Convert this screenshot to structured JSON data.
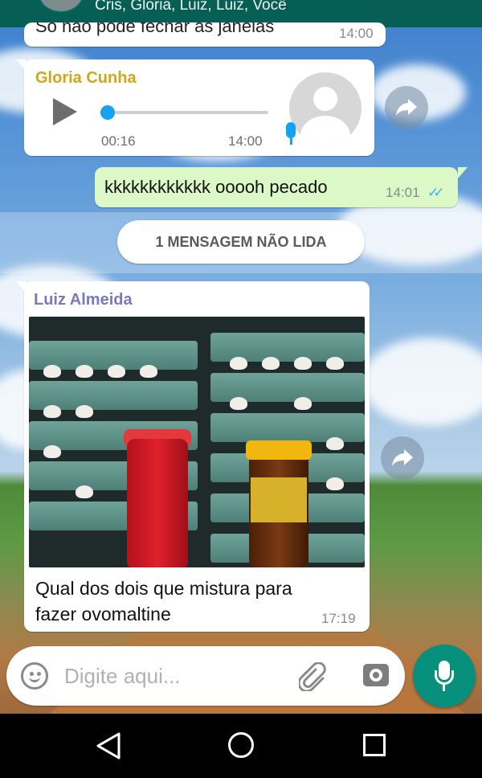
{
  "header": {
    "participants": "Cris, Gloria, Luiz, Luiz, Você"
  },
  "messages": {
    "previous": {
      "text": "Só não pode fechar as janelas",
      "time": "14:00"
    },
    "audio": {
      "sender": "Gloria Cunha",
      "sender_color": "#d4a515",
      "duration": "00:16",
      "time": "14:00",
      "progress": 0.0
    },
    "outgoing": {
      "text": "kkkkkkkkkkkk ooooh pecado",
      "time": "14:01",
      "status": "read"
    },
    "unread_banner": "1 MENSAGEM NÃO LIDA",
    "image": {
      "sender": "Luiz Almeida",
      "sender_color": "#7b79b8",
      "caption": "Qual dos dois que mistura para fazer ovomaltine",
      "time": "17:19"
    }
  },
  "input": {
    "placeholder": "Digite aqui..."
  },
  "icons": {
    "emoji": "emoji-icon",
    "attach": "paperclip-icon",
    "camera": "camera-icon",
    "mic": "microphone-icon",
    "forward": "forward-icon",
    "play": "play-icon"
  },
  "colors": {
    "header": "#075e54",
    "outgoing_bubble": "#dcf8c6",
    "accent": "#07907c",
    "read_ticks": "#34b7f1"
  }
}
